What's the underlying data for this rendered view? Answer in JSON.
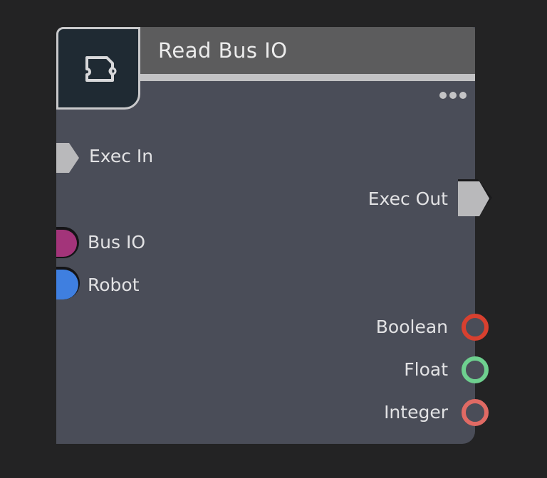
{
  "node": {
    "title": "Read Bus IO",
    "icon": "bus-io-node-icon",
    "more_icon": "more-options-icon"
  },
  "inputs": [
    {
      "label": "Exec In",
      "type": "exec",
      "color": "#b9b9bb"
    },
    {
      "label": "Bus IO",
      "type": "data",
      "color": "#a3347a"
    },
    {
      "label": "Robot",
      "type": "data",
      "color": "#3f7fe0"
    }
  ],
  "outputs": [
    {
      "label": "Exec Out",
      "type": "exec",
      "color": "#b9b9bb"
    },
    {
      "label": "Boolean",
      "type": "data",
      "color": "#d8402f"
    },
    {
      "label": "Float",
      "type": "data",
      "color": "#6ed08f"
    },
    {
      "label": "Integer",
      "type": "data",
      "color": "#e06a64"
    }
  ]
}
